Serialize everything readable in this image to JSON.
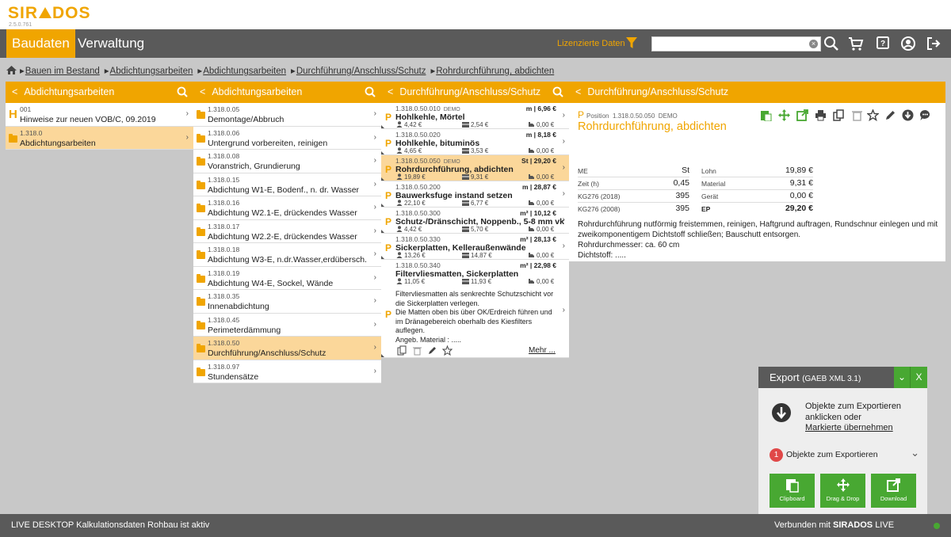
{
  "app": {
    "logo": "SIRADOS",
    "version": "2.5.0.761"
  },
  "nav": {
    "tab_active": "Baudaten",
    "tab2": "Verwaltung",
    "licensed": "Lizenzierte Daten",
    "search_placeholder": ""
  },
  "breadcrumb": [
    "Bauen im Bestand",
    "Abdichtungsarbeiten",
    "Abdichtungsarbeiten",
    "Durchführung/Anschluss/Schutz",
    "Rohrdurchführung, abdichten"
  ],
  "col1": {
    "title": "Abdichtungsarbeiten",
    "rows": [
      {
        "code": "001",
        "name": "Hinweise zur neuen VOB/C, 09.2019"
      },
      {
        "code": "1.318.0",
        "name": "Abdichtungsarbeiten"
      }
    ]
  },
  "col2": {
    "title": "Abdichtungsarbeiten",
    "rows": [
      {
        "code": "1.318.0.05",
        "name": "Demontage/Abbruch"
      },
      {
        "code": "1.318.0.06",
        "name": "Untergrund vorbereiten, reinigen"
      },
      {
        "code": "1.318.0.08",
        "name": "Voranstrich, Grundierung"
      },
      {
        "code": "1.318.0.15",
        "name": "Abdichtung W1-E, Bodenf., n. dr. Wasser"
      },
      {
        "code": "1.318.0.16",
        "name": "Abdichtung W2.1-E, drückendes Wasser"
      },
      {
        "code": "1.318.0.17",
        "name": "Abdichtung W2.2-E, drückendes Wasser"
      },
      {
        "code": "1.318.0.18",
        "name": "Abdichtung W3-E, n.dr.Wasser,erdübersch."
      },
      {
        "code": "1.318.0.19",
        "name": "Abdichtung W4-E, Sockel, Wände"
      },
      {
        "code": "1.318.0.35",
        "name": "Innenabdichtung"
      },
      {
        "code": "1.318.0.45",
        "name": "Perimeterdämmung"
      },
      {
        "code": "1.318.0.50",
        "name": "Durchführung/Anschluss/Schutz"
      },
      {
        "code": "1.318.0.97",
        "name": "Stundensätze"
      }
    ]
  },
  "col3": {
    "title": "Durchführung/Anschluss/Schutz",
    "demo": "DEMO",
    "rows": [
      {
        "code": "1.318.0.50.010",
        "demo": "DEMO",
        "unit": "m | 6,96 €",
        "name": "Hohlkehle, Mörtel",
        "v1": "4,42 €",
        "v2": "2,54 €",
        "v3": "0,00 €"
      },
      {
        "code": "1.318.0.50.020",
        "demo": "",
        "unit": "m | 8,18 €",
        "name": "Hohlkehle, bituminös",
        "v1": "4,65 €",
        "v2": "3,53 €",
        "v3": "0,00 €"
      },
      {
        "code": "1.318.0.50.050",
        "demo": "DEMO",
        "unit": "St | 29,20 €",
        "name": "Rohrdurchführung, abdichten",
        "v1": "19,89 €",
        "v2": "9,31 €",
        "v3": "0,00 €"
      },
      {
        "code": "1.318.0.50.200",
        "demo": "",
        "unit": "m | 28,87 €",
        "name": "Bauwerksfuge instand setzen",
        "v1": "22,10 €",
        "v2": "6,77 €",
        "v3": "0,00 €"
      },
      {
        "code": "1.318.0.50.300",
        "demo": "",
        "unit": "m² | 10,12 €",
        "name": "Schutz-/Dränschicht, Noppenb., 5-8 mm vk",
        "v1": "4,42 €",
        "v2": "5,70 €",
        "v3": "0,00 €"
      },
      {
        "code": "1.318.0.50.330",
        "demo": "",
        "unit": "m² | 28,13 €",
        "name": "Sickerplatten, Kelleraußenwände",
        "v1": "13,26 €",
        "v2": "14,87 €",
        "v3": "0,00 €"
      },
      {
        "code": "1.318.0.50.340",
        "demo": "",
        "unit": "m² | 22,98 €",
        "name": "Filtervliesmatten, Sickerplatten",
        "v1": "11,05 €",
        "v2": "11,93 €",
        "v3": "0,00 €"
      }
    ],
    "expanded_text": [
      "Filtervliesmatten als senkrechte Schutzschicht vor",
      "die Sickerplatten verlegen.",
      "Die Matten oben bis über OK/Erdreich führen und",
      "im Dränagebereich oberhalb des Kiesfilters",
      "auflegen.",
      "Angeb. Material    :         ....."
    ],
    "more": "Mehr ..."
  },
  "detail": {
    "title": "Durchführung/Anschluss/Schutz",
    "pos_label": "Position",
    "pos_code": "1.318.0.50.050",
    "demo": "DEMO",
    "name": "Rohrdurchführung, abdichten",
    "left": [
      {
        "k": "ME",
        "v": "St"
      },
      {
        "k": "Zeit (h)",
        "v": "0,45"
      },
      {
        "k": "KG276 (2018)",
        "v": "395"
      },
      {
        "k": "KG276 (2008)",
        "v": "395"
      }
    ],
    "right": [
      {
        "k": "Lohn",
        "v": "19,89 €"
      },
      {
        "k": "Material",
        "v": "9,31 €"
      },
      {
        "k": "Gerät",
        "v": "0,00 €"
      },
      {
        "k": "EP",
        "v": "29,20 €"
      }
    ],
    "desc": [
      "Rohrdurchführung nutförmig freistemmen, reinigen, Haftgrund auftragen, Rundschnur einlegen und mit",
      "zweikomponentigem Dichtstoff schließen; Bauschutt entsorgen.",
      "Rohrdurchmesser: ca. 60 cm",
      "Dichtstoff: ....."
    ]
  },
  "export": {
    "title": "Export",
    "subtitle": "(GAEB XML 3.1)",
    "line1": "Objekte zum Exportieren",
    "line2": "anklicken oder",
    "link": "Markierte übernehmen",
    "count": "1",
    "count_label": "Objekte zum Exportieren",
    "btn1": "Clipboard",
    "btn2": "Drag & Drop",
    "btn3": "Download"
  },
  "status": {
    "left": "LIVE DESKTOP Kalkulationsdaten Rohbau ist aktiv",
    "right_prefix": "Verbunden mit",
    "right_brand": "SIRADOS",
    "right_suffix": "LIVE"
  },
  "colors": {
    "accent": "#f0a500",
    "dark": "#5a5a5a",
    "green": "#48a832",
    "selected": "#fbd79a"
  }
}
